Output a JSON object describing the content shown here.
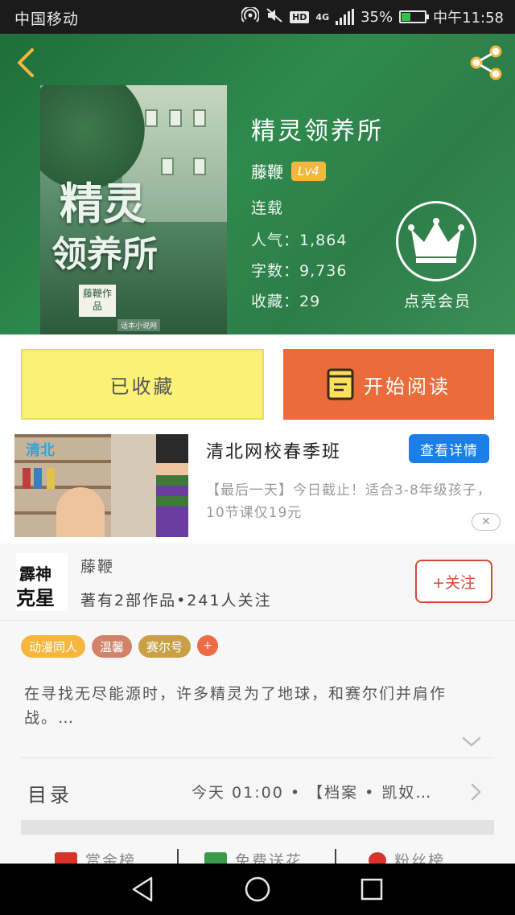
{
  "status_bar": {
    "carrier": "中国移动",
    "hd": "HD",
    "network": "4G",
    "battery_level": "35%",
    "time": "中午11:58"
  },
  "book": {
    "title": "精灵领养所",
    "author": "藤鞭",
    "level": "Lv4",
    "status": "连载",
    "popularity_label": "人气：",
    "popularity": "1,864",
    "words_label": "字数：",
    "words": "9,736",
    "favorites_label": "收藏：",
    "favorites": "29",
    "cover": {
      "title_art_line1": "精灵",
      "title_art_line2": "领养所",
      "author_tag": "藤鞭作品",
      "publisher": "话本小说网"
    }
  },
  "vip": {
    "label": "点亮会员"
  },
  "actions": {
    "favorite_label": "已收藏",
    "read_label": "开始阅读"
  },
  "ad": {
    "logo": "清北",
    "title": "清北网校春季班",
    "button": "查看详情",
    "description": "【最后一天】今日截止！适合3-8年级孩子，10节课仅19元",
    "close": "✕"
  },
  "author_section": {
    "name": "藤鞭",
    "meta": "著有2部作品•241人关注",
    "follow_label": "+关注",
    "avatar_text_1": "霹神",
    "avatar_text_2": "克星"
  },
  "tags": [
    {
      "label": "动漫同人",
      "color": "#f4b63d"
    },
    {
      "label": "温馨",
      "color": "#d3826a"
    },
    {
      "label": "赛尔号",
      "color": "#caa047"
    }
  ],
  "tag_add": "+",
  "description": "在寻找无尽能源时，许多精灵为了地球，和赛尔们并肩作战。…",
  "catalog": {
    "label": "目录",
    "latest": "今天 01:00 • 【档案 • 凯奴…"
  },
  "bottom_tabs": [
    {
      "label": "赏金榜"
    },
    {
      "label": "免费送花"
    },
    {
      "label": "粉丝榜"
    }
  ],
  "colors": {
    "hero_green": "#2f8a4e",
    "favorite_yellow": "#fbf176",
    "read_orange": "#ec6b3a",
    "ad_blue": "#1a7fe8",
    "follow_red": "#d44a33"
  }
}
